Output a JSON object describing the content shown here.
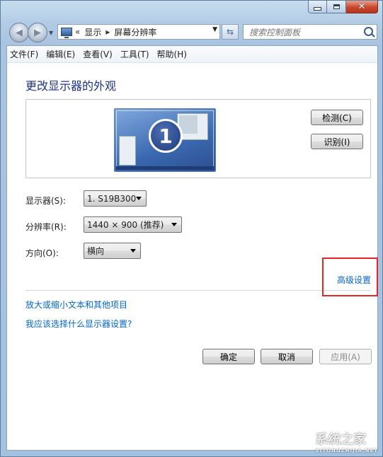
{
  "addressbar": {
    "crumbs": [
      "显示",
      "屏幕分辨率"
    ],
    "separator_prefix": "«",
    "separator": "▸"
  },
  "search": {
    "placeholder": "搜索控制面板"
  },
  "menubar": [
    "文件(F)",
    "编辑(E)",
    "查看(V)",
    "工具(T)",
    "帮助(H)"
  ],
  "page": {
    "title": "更改显示器的外观"
  },
  "monitor": {
    "number": "1",
    "detect_label": "检测(C)",
    "identify_label": "识别(I)"
  },
  "settings": {
    "display_label": "显示器(S):",
    "display_value": "1. S19B300",
    "resolution_label": "分辨率(R):",
    "resolution_value": "1440 × 900 (推荐)",
    "orientation_label": "方向(O):",
    "orientation_value": "横向"
  },
  "links": {
    "advanced": "高级设置",
    "text_size": "放大或缩小文本和其他项目",
    "which_setting": "我应该选择什么显示器设置?"
  },
  "buttons": {
    "ok": "确定",
    "cancel": "取消",
    "apply": "应用(A)"
  },
  "watermark": {
    "text": "系统之家",
    "sub": "XITONGZHIJIA.NET"
  },
  "colors": {
    "link": "#0066cc",
    "title": "#1e3287",
    "highlight": "#e0282a"
  }
}
